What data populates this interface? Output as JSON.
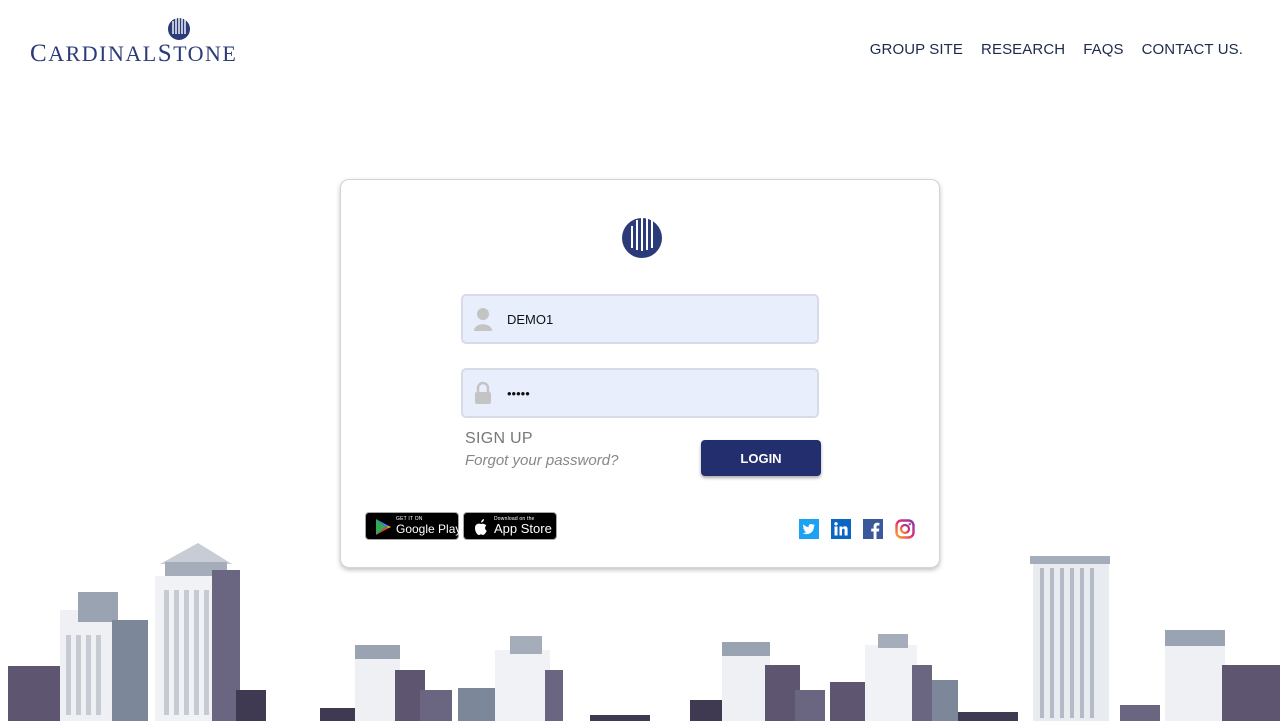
{
  "brand": {
    "name_first": "C",
    "name_rest": "ARDINAL",
    "name_first2": "S",
    "name_rest2": "TONE"
  },
  "nav": {
    "items": [
      {
        "label": "GROUP SITE"
      },
      {
        "label": "RESEARCH"
      },
      {
        "label": "FAQS"
      },
      {
        "label": "CONTACT US."
      }
    ]
  },
  "login": {
    "username_value": "DEMO1",
    "password_value": "12345",
    "signup_label": "SIGN UP",
    "forgot_label": "Forgot your password?",
    "login_label": "LOGIN"
  },
  "stores": {
    "google_small": "GET IT ON",
    "google_big": "Google Play",
    "apple_small": "Download on the",
    "apple_big": "App Store"
  },
  "social": {
    "icons": [
      "twitter-icon",
      "linkedin-icon",
      "facebook-icon",
      "instagram-icon"
    ]
  },
  "colors": {
    "brand_navy": "#222e6e",
    "field_bg": "#e8eefc",
    "text": "#1d2a4a"
  }
}
